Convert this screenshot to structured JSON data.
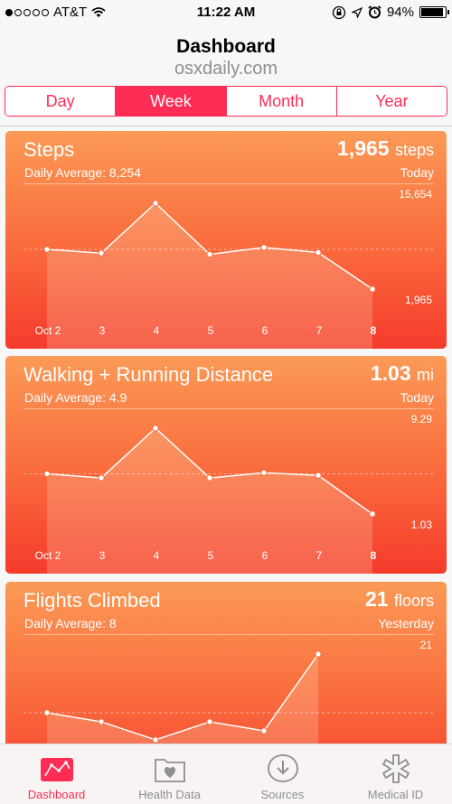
{
  "status_bar": {
    "carrier": "AT&T",
    "time": "11:22 AM",
    "battery": "94%",
    "battery_level": 0.94
  },
  "header": {
    "title": "Dashboard",
    "subtitle": "osxdaily.com"
  },
  "segments": [
    {
      "label": "Day",
      "active": false
    },
    {
      "label": "Week",
      "active": true
    },
    {
      "label": "Month",
      "active": false
    },
    {
      "label": "Year",
      "active": false
    }
  ],
  "cards": [
    {
      "title": "Steps",
      "daily_average": "Daily Average: 8,254",
      "value": "1,965",
      "unit": "steps",
      "when": "Today",
      "max_label": "15,654",
      "min_label": "1,965"
    },
    {
      "title": "Walking + Running Distance",
      "daily_average": "Daily Average: 4.9",
      "value": "1.03",
      "unit": "mi",
      "when": "Today",
      "max_label": "9.29",
      "min_label": "1.03"
    },
    {
      "title": "Flights Climbed",
      "daily_average": "Daily Average: 8",
      "value": "21",
      "unit": "floors",
      "when": "Yesterday",
      "max_label": "21",
      "min_label": ""
    }
  ],
  "x_labels": [
    "Oct 2",
    "3",
    "4",
    "5",
    "6",
    "7",
    "8"
  ],
  "chart_data": [
    {
      "type": "line",
      "title": "Steps",
      "x": [
        "Oct 2",
        "3",
        "4",
        "5",
        "6",
        "7",
        "8"
      ],
      "series": [
        {
          "values": [
            8300,
            7700,
            15654,
            7500,
            8600,
            7800,
            1965
          ]
        }
      ],
      "ylim": [
        1965,
        15654
      ]
    },
    {
      "type": "line",
      "title": "Walking + Running Distance",
      "x": [
        "Oct 2",
        "3",
        "4",
        "5",
        "6",
        "7",
        "8"
      ],
      "series": [
        {
          "values": [
            4.9,
            4.5,
            9.29,
            4.5,
            5.0,
            4.75,
            1.03
          ]
        }
      ],
      "ylim": [
        1.03,
        9.29
      ]
    },
    {
      "type": "line",
      "title": "Flights Climbed",
      "x": [
        "Oct 2",
        "3",
        "4",
        "5",
        "6",
        "7"
      ],
      "series": [
        {
          "values": [
            8,
            6,
            2,
            6,
            4,
            21
          ]
        }
      ],
      "ylim": [
        2,
        21
      ]
    }
  ],
  "tabs": [
    {
      "label": "Dashboard",
      "icon": "dashboard-icon",
      "active": true
    },
    {
      "label": "Health Data",
      "icon": "health-data-icon",
      "active": false
    },
    {
      "label": "Sources",
      "icon": "sources-icon",
      "active": false
    },
    {
      "label": "Medical ID",
      "icon": "medical-id-icon",
      "active": false
    }
  ],
  "colors": {
    "accent": "#ff2d55",
    "card_top": "#fb9a56",
    "card_bottom": "#f53b2c"
  }
}
